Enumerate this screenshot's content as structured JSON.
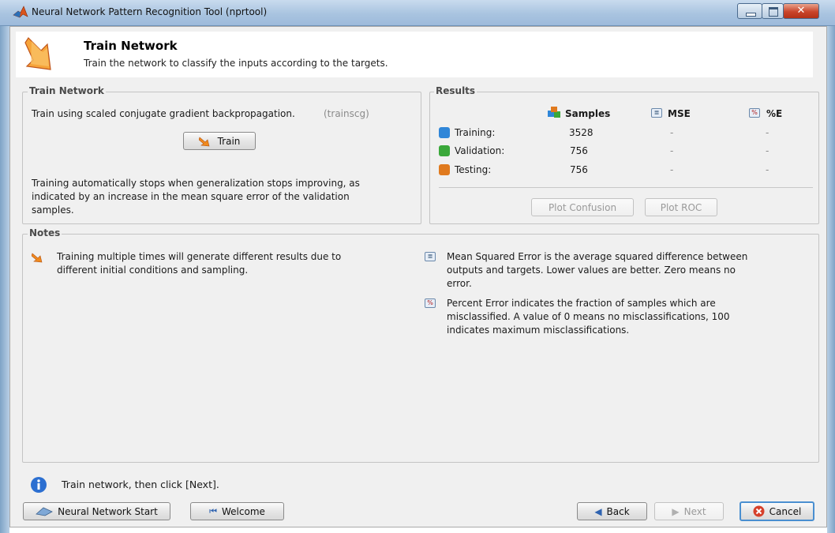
{
  "window": {
    "title": "Neural Network Pattern Recognition Tool (nprtool)"
  },
  "header": {
    "title": "Train Network",
    "subtitle": "Train the network to classify the inputs according to the targets."
  },
  "train_group": {
    "legend": "Train Network",
    "method_text": "Train using scaled conjugate gradient backpropagation.",
    "method_code": "(trainscg)",
    "train_button": "Train",
    "info_text": "Training automatically stops when generalization stops improving, as indicated by an increase in the mean square error of the validation samples."
  },
  "results": {
    "legend": "Results",
    "headers": {
      "samples": "Samples",
      "mse": "MSE",
      "pe": "%E"
    },
    "rows": [
      {
        "label": "Training:",
        "samples": "3528",
        "mse": "-",
        "pe": "-",
        "color": "#2f86d8"
      },
      {
        "label": "Validation:",
        "samples": "756",
        "mse": "-",
        "pe": "-",
        "color": "#3aa83a"
      },
      {
        "label": "Testing:",
        "samples": "756",
        "mse": "-",
        "pe": "-",
        "color": "#e07a1e"
      }
    ],
    "plot_confusion": "Plot Confusion",
    "plot_roc": "Plot ROC"
  },
  "notes": {
    "legend": "Notes",
    "left": "Training multiple times will generate different results due to different initial conditions and sampling.",
    "mse": "Mean Squared Error is the average squared difference between outputs and targets. Lower values are better. Zero means no error.",
    "pe": "Percent Error  indicates the fraction of samples which are misclassified. A value of 0 means no misclassifications, 100 indicates maximum misclassifications."
  },
  "status": {
    "text": "Train network, then click [Next]."
  },
  "footer": {
    "nn_start": "Neural Network Start",
    "welcome": "Welcome",
    "back": "Back",
    "next": "Next",
    "cancel": "Cancel"
  },
  "colors": {
    "accent": "#4a8fd0",
    "orange": "#f08a1e",
    "info_blue": "#2c6fd1"
  }
}
